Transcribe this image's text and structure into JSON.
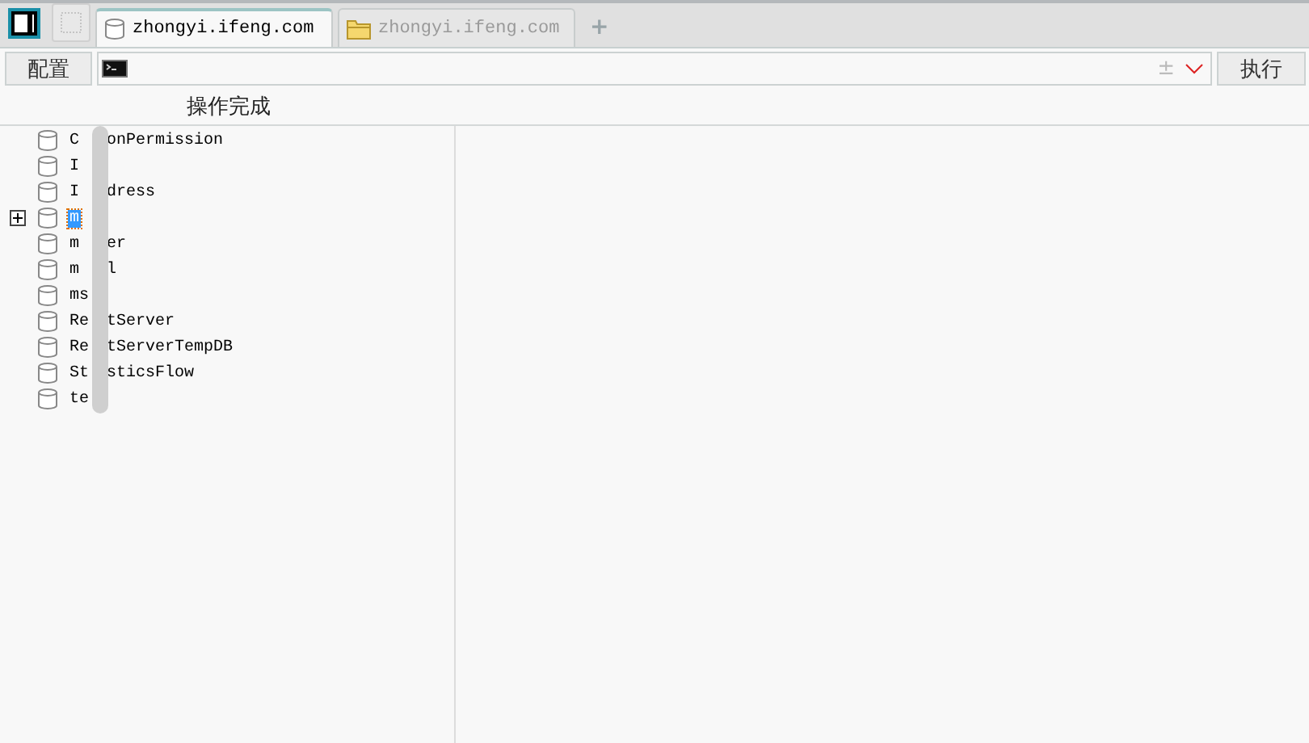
{
  "tabs": [
    {
      "kind": "database",
      "label": "zhongyi.ifeng.com",
      "selected": true
    },
    {
      "kind": "folder",
      "label": "zhongyi.ifeng.com",
      "selected": false
    }
  ],
  "new_tab_button": "+",
  "toolbar": {
    "config_button": "配置",
    "plus_minus": "±",
    "run_button": "执行"
  },
  "status": "操作完成",
  "tree": {
    "items": [
      {
        "start": "C",
        "end": "onPermission",
        "expandable": false,
        "selected": false
      },
      {
        "start": "I",
        "expandable": false,
        "selected": false
      },
      {
        "start": "I",
        "end": "dress",
        "expandable": false,
        "selected": false
      },
      {
        "start": "m",
        "expandable": true,
        "selected": true
      },
      {
        "start": "m",
        "end": "er",
        "expandable": false,
        "selected": false
      },
      {
        "start": "m",
        "end": "l",
        "expandable": false,
        "selected": false
      },
      {
        "start": "ms",
        "expandable": false,
        "selected": false
      },
      {
        "start": "Re",
        "end": "tServer",
        "expandable": false,
        "selected": false
      },
      {
        "start": "Re",
        "end": "tServerTempDB",
        "expandable": false,
        "selected": false
      },
      {
        "start": "St",
        "end": "sticsFlow",
        "expandable": false,
        "selected": false
      },
      {
        "start": "te",
        "expandable": false,
        "selected": false
      }
    ]
  }
}
